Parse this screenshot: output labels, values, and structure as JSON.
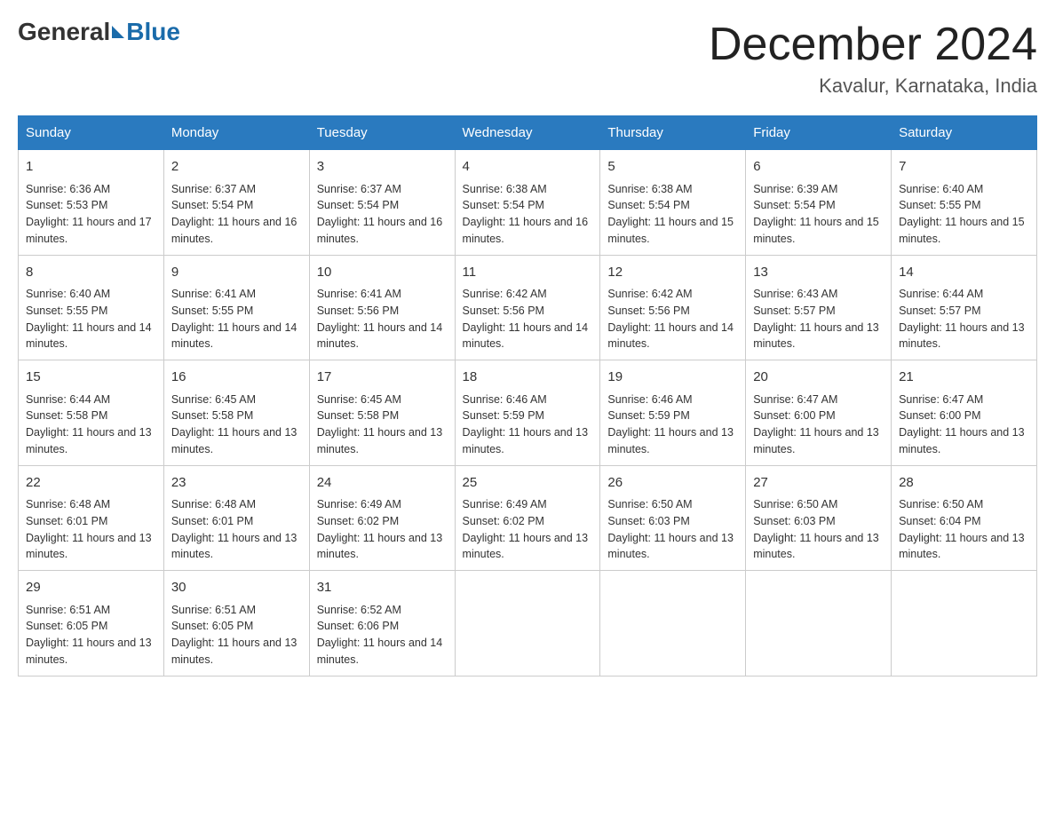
{
  "header": {
    "logo_general": "General",
    "logo_blue": "Blue",
    "title": "December 2024",
    "subtitle": "Kavalur, Karnataka, India"
  },
  "weekdays": [
    "Sunday",
    "Monday",
    "Tuesday",
    "Wednesday",
    "Thursday",
    "Friday",
    "Saturday"
  ],
  "weeks": [
    [
      {
        "day": "1",
        "sunrise": "6:36 AM",
        "sunset": "5:53 PM",
        "daylight": "11 hours and 17 minutes."
      },
      {
        "day": "2",
        "sunrise": "6:37 AM",
        "sunset": "5:54 PM",
        "daylight": "11 hours and 16 minutes."
      },
      {
        "day": "3",
        "sunrise": "6:37 AM",
        "sunset": "5:54 PM",
        "daylight": "11 hours and 16 minutes."
      },
      {
        "day": "4",
        "sunrise": "6:38 AM",
        "sunset": "5:54 PM",
        "daylight": "11 hours and 16 minutes."
      },
      {
        "day": "5",
        "sunrise": "6:38 AM",
        "sunset": "5:54 PM",
        "daylight": "11 hours and 15 minutes."
      },
      {
        "day": "6",
        "sunrise": "6:39 AM",
        "sunset": "5:54 PM",
        "daylight": "11 hours and 15 minutes."
      },
      {
        "day": "7",
        "sunrise": "6:40 AM",
        "sunset": "5:55 PM",
        "daylight": "11 hours and 15 minutes."
      }
    ],
    [
      {
        "day": "8",
        "sunrise": "6:40 AM",
        "sunset": "5:55 PM",
        "daylight": "11 hours and 14 minutes."
      },
      {
        "day": "9",
        "sunrise": "6:41 AM",
        "sunset": "5:55 PM",
        "daylight": "11 hours and 14 minutes."
      },
      {
        "day": "10",
        "sunrise": "6:41 AM",
        "sunset": "5:56 PM",
        "daylight": "11 hours and 14 minutes."
      },
      {
        "day": "11",
        "sunrise": "6:42 AM",
        "sunset": "5:56 PM",
        "daylight": "11 hours and 14 minutes."
      },
      {
        "day": "12",
        "sunrise": "6:42 AM",
        "sunset": "5:56 PM",
        "daylight": "11 hours and 14 minutes."
      },
      {
        "day": "13",
        "sunrise": "6:43 AM",
        "sunset": "5:57 PM",
        "daylight": "11 hours and 13 minutes."
      },
      {
        "day": "14",
        "sunrise": "6:44 AM",
        "sunset": "5:57 PM",
        "daylight": "11 hours and 13 minutes."
      }
    ],
    [
      {
        "day": "15",
        "sunrise": "6:44 AM",
        "sunset": "5:58 PM",
        "daylight": "11 hours and 13 minutes."
      },
      {
        "day": "16",
        "sunrise": "6:45 AM",
        "sunset": "5:58 PM",
        "daylight": "11 hours and 13 minutes."
      },
      {
        "day": "17",
        "sunrise": "6:45 AM",
        "sunset": "5:58 PM",
        "daylight": "11 hours and 13 minutes."
      },
      {
        "day": "18",
        "sunrise": "6:46 AM",
        "sunset": "5:59 PM",
        "daylight": "11 hours and 13 minutes."
      },
      {
        "day": "19",
        "sunrise": "6:46 AM",
        "sunset": "5:59 PM",
        "daylight": "11 hours and 13 minutes."
      },
      {
        "day": "20",
        "sunrise": "6:47 AM",
        "sunset": "6:00 PM",
        "daylight": "11 hours and 13 minutes."
      },
      {
        "day": "21",
        "sunrise": "6:47 AM",
        "sunset": "6:00 PM",
        "daylight": "11 hours and 13 minutes."
      }
    ],
    [
      {
        "day": "22",
        "sunrise": "6:48 AM",
        "sunset": "6:01 PM",
        "daylight": "11 hours and 13 minutes."
      },
      {
        "day": "23",
        "sunrise": "6:48 AM",
        "sunset": "6:01 PM",
        "daylight": "11 hours and 13 minutes."
      },
      {
        "day": "24",
        "sunrise": "6:49 AM",
        "sunset": "6:02 PM",
        "daylight": "11 hours and 13 minutes."
      },
      {
        "day": "25",
        "sunrise": "6:49 AM",
        "sunset": "6:02 PM",
        "daylight": "11 hours and 13 minutes."
      },
      {
        "day": "26",
        "sunrise": "6:50 AM",
        "sunset": "6:03 PM",
        "daylight": "11 hours and 13 minutes."
      },
      {
        "day": "27",
        "sunrise": "6:50 AM",
        "sunset": "6:03 PM",
        "daylight": "11 hours and 13 minutes."
      },
      {
        "day": "28",
        "sunrise": "6:50 AM",
        "sunset": "6:04 PM",
        "daylight": "11 hours and 13 minutes."
      }
    ],
    [
      {
        "day": "29",
        "sunrise": "6:51 AM",
        "sunset": "6:05 PM",
        "daylight": "11 hours and 13 minutes."
      },
      {
        "day": "30",
        "sunrise": "6:51 AM",
        "sunset": "6:05 PM",
        "daylight": "11 hours and 13 minutes."
      },
      {
        "day": "31",
        "sunrise": "6:52 AM",
        "sunset": "6:06 PM",
        "daylight": "11 hours and 14 minutes."
      },
      null,
      null,
      null,
      null
    ]
  ]
}
